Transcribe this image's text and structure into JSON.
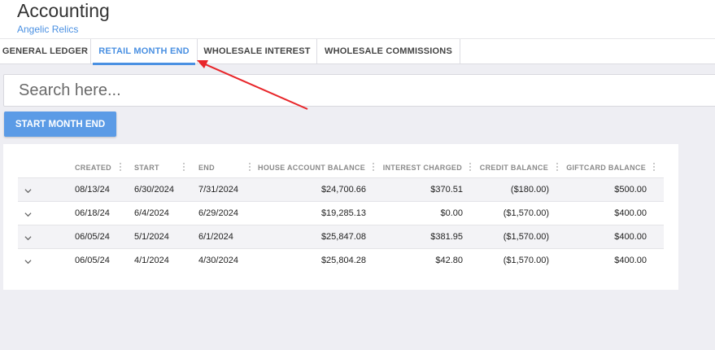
{
  "header": {
    "title": "Accounting",
    "subtitle": "Angelic Relics"
  },
  "tabs": [
    {
      "label": "GENERAL LEDGER"
    },
    {
      "label": "RETAIL MONTH END"
    },
    {
      "label": "WHOLESALE INTEREST"
    },
    {
      "label": "WHOLESALE COMMISSIONS"
    }
  ],
  "active_tab": "RETAIL MONTH END",
  "search": {
    "placeholder": "Search here...",
    "value": ""
  },
  "start_button": {
    "label": "START MONTH END"
  },
  "table": {
    "columns": [
      "CREATED",
      "START",
      "END",
      "HOUSE ACCOUNT BALANCE",
      "INTEREST CHARGED",
      "CREDIT BALANCE",
      "GIFTCARD BALANCE"
    ],
    "rows": [
      [
        "08/13/24",
        "6/30/2024",
        "7/31/2024",
        "$24,700.66",
        "$370.51",
        "($180.00)",
        "$500.00"
      ],
      [
        "06/18/24",
        "6/4/2024",
        "6/29/2024",
        "$19,285.13",
        "$0.00",
        "($1,570.00)",
        "$400.00"
      ],
      [
        "06/05/24",
        "5/1/2024",
        "6/1/2024",
        "$25,847.08",
        "$381.95",
        "($1,570.00)",
        "$400.00"
      ],
      [
        "06/05/24",
        "4/1/2024",
        "4/30/2024",
        "$25,804.28",
        "$42.80",
        "($1,570.00)",
        "$400.00"
      ]
    ]
  },
  "colors": {
    "accent": "#4a90e2",
    "button": "#5b9be6",
    "annotation_arrow": "#e8262a"
  }
}
